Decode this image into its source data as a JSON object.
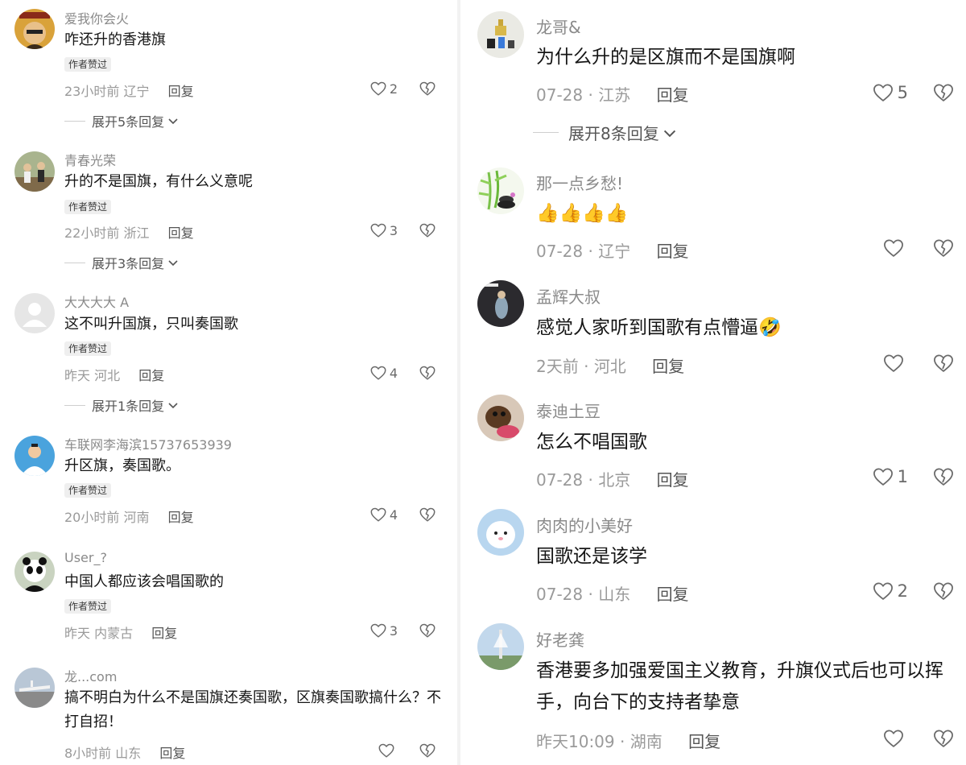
{
  "left": [
    {
      "name": "爱我你会火",
      "text": "咋还升的香港旗",
      "badge": "作者赞过",
      "time": "23小时前",
      "loc": "辽宁",
      "reply": "回复",
      "likes": "2",
      "expand": "展开5条回复"
    },
    {
      "name": "青春光荣",
      "text": "升的不是国旗，有什么义意呢",
      "badge": "作者赞过",
      "time": "22小时前",
      "loc": "浙江",
      "reply": "回复",
      "likes": "3",
      "expand": "展开3条回复"
    },
    {
      "name": "大大大大 A",
      "text": "这不叫升国旗，只叫奏国歌",
      "badge": "作者赞过",
      "time": "昨天",
      "loc": "河北",
      "reply": "回复",
      "likes": "4",
      "expand": "展开1条回复"
    },
    {
      "name": "车联网李海滨15737653939",
      "text": "升区旗，奏国歌。",
      "badge": "作者赞过",
      "time": "20小时前",
      "loc": "河南",
      "reply": "回复",
      "likes": "4"
    },
    {
      "name": "User_?",
      "text": "中国人都应该会唱国歌的",
      "badge": "作者赞过",
      "time": "昨天",
      "loc": "内蒙古",
      "reply": "回复",
      "likes": "3"
    },
    {
      "name": "龙...com",
      "text": "搞不明白为什么不是国旗还奏国歌，区旗奏国歌搞什么？不打自招！",
      "time": "8小时前",
      "loc": "山东",
      "reply": "回复",
      "likes": ""
    }
  ],
  "right": [
    {
      "name": "龙哥&",
      "text": "为什么升的是区旗而不是国旗啊",
      "time": "07-28",
      "loc": "江苏",
      "reply": "回复",
      "likes": "5",
      "expand": "展开8条回复"
    },
    {
      "name": "那一点乡愁!",
      "text": "👍👍👍👍",
      "time": "07-28",
      "loc": "辽宁",
      "reply": "回复",
      "likes": ""
    },
    {
      "name": "孟辉大叔",
      "text": "感觉人家听到国歌有点懵逼🤣",
      "time": "2天前",
      "loc": "河北",
      "reply": "回复",
      "likes": ""
    },
    {
      "name": "泰迪土豆",
      "text": "怎么不唱国歌",
      "time": "07-28",
      "loc": "北京",
      "reply": "回复",
      "likes": "1"
    },
    {
      "name": "肉肉的小美好",
      "text": "国歌还是该学",
      "time": "07-28",
      "loc": "山东",
      "reply": "回复",
      "likes": "2"
    },
    {
      "name": "好老龚",
      "text": "香港要多加强爱国主义教育，升旗仪式后也可以挥手，向台下的支持者挚意",
      "time": "昨天10:09",
      "loc": "湖南",
      "reply": "回复",
      "likes": ""
    }
  ],
  "meta_separator": " · ",
  "colors": {
    "text": "#161616",
    "name": "#8a8a8a",
    "meta": "#9a9a9a",
    "badge_bg": "#efefef"
  }
}
